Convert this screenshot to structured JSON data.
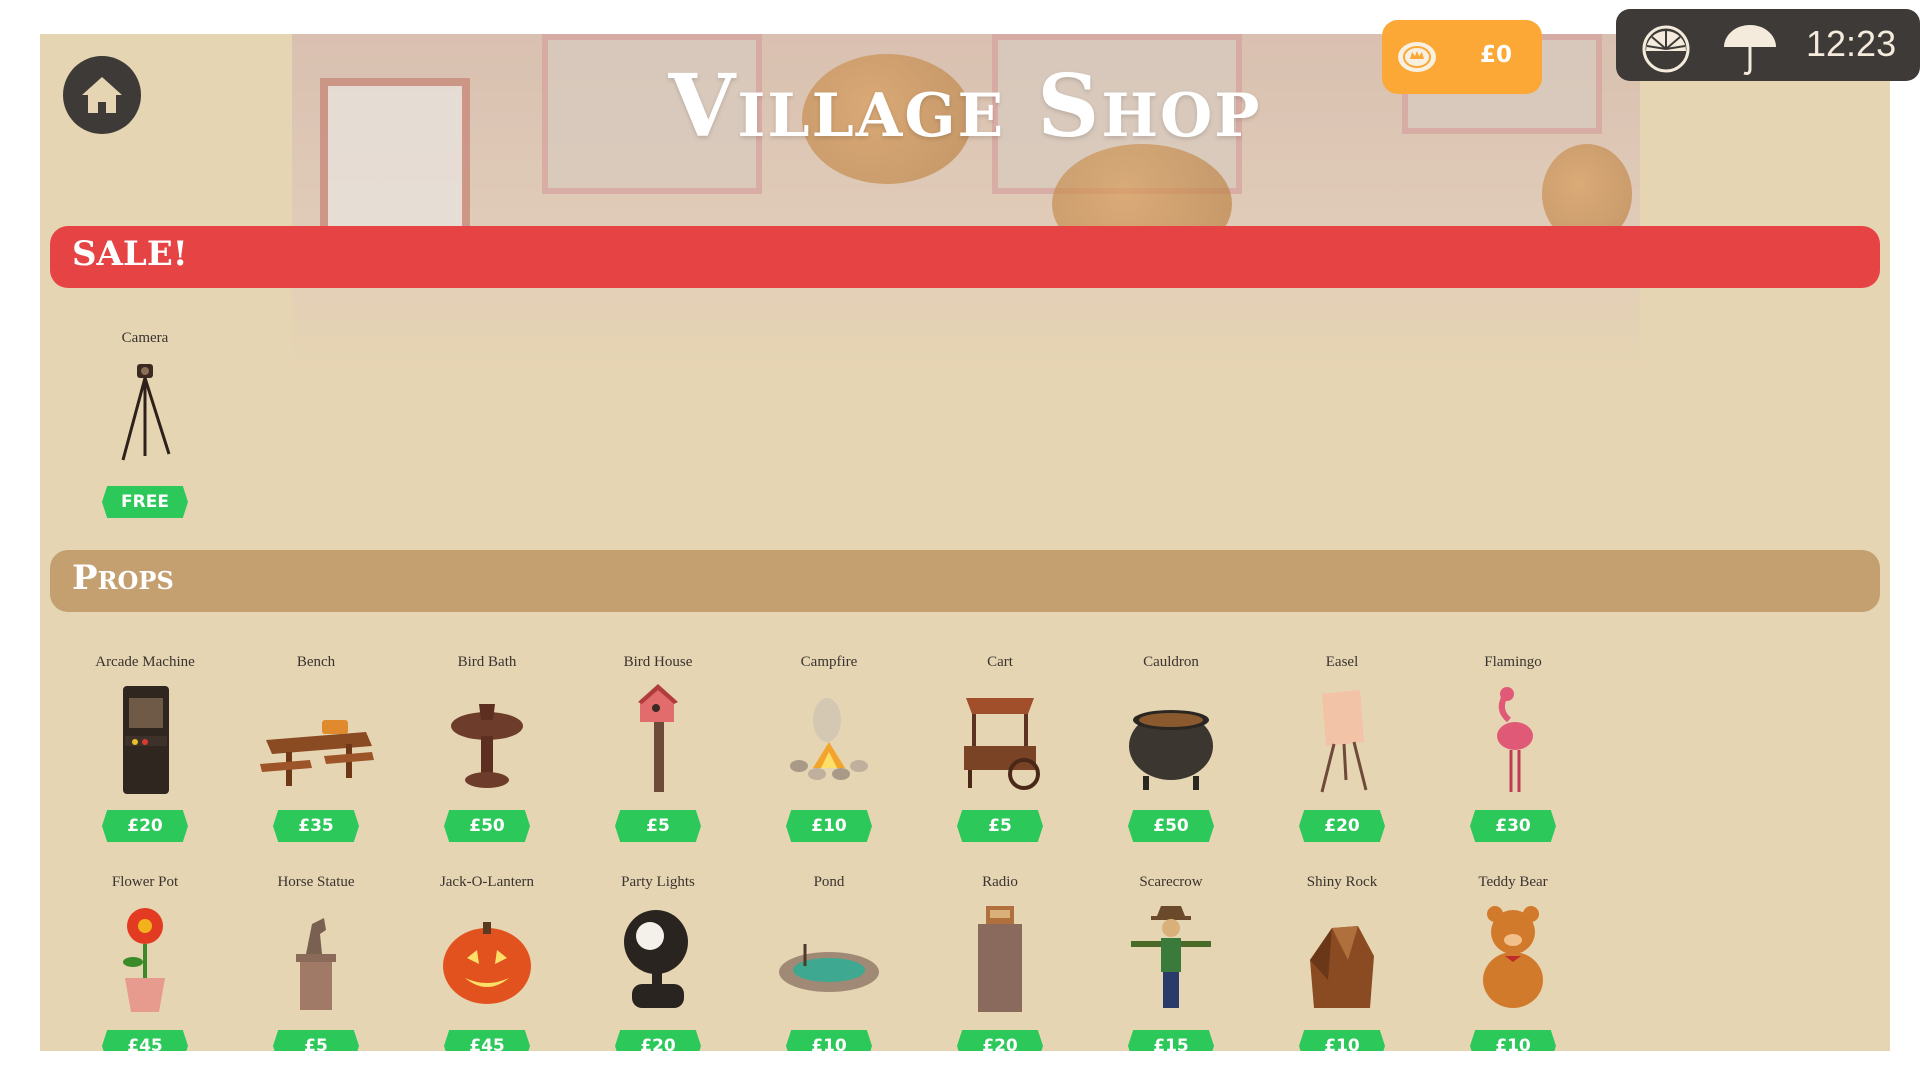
{
  "header": {
    "title": "Village Shop"
  },
  "hud": {
    "coins": "£0",
    "time": "12:23"
  },
  "sections": {
    "sale": {
      "label": "SALE!",
      "items": [
        {
          "name": "Camera",
          "price": "FREE"
        }
      ]
    },
    "props": {
      "label": "Props",
      "items": [
        {
          "name": "Arcade Machine",
          "price": "£20"
        },
        {
          "name": "Bench",
          "price": "£35"
        },
        {
          "name": "Bird Bath",
          "price": "£50"
        },
        {
          "name": "Bird House",
          "price": "£5"
        },
        {
          "name": "Campfire",
          "price": "£10"
        },
        {
          "name": "Cart",
          "price": "£5"
        },
        {
          "name": "Cauldron",
          "price": "£50"
        },
        {
          "name": "Easel",
          "price": "£20"
        },
        {
          "name": "Flamingo",
          "price": "£30"
        },
        {
          "name": "Flower Pot",
          "price": "£45"
        },
        {
          "name": "Horse Statue",
          "price": "£5"
        },
        {
          "name": "Jack-O-Lantern",
          "price": "£45"
        },
        {
          "name": "Party Lights",
          "price": "£20"
        },
        {
          "name": "Pond",
          "price": "£10"
        },
        {
          "name": "Radio",
          "price": "£20"
        },
        {
          "name": "Scarecrow",
          "price": "£15"
        },
        {
          "name": "Shiny Rock",
          "price": "£10"
        },
        {
          "name": "Teddy Bear",
          "price": "£10"
        }
      ]
    }
  },
  "colors": {
    "background": "#e6d5b3",
    "sale_bar": "#e54344",
    "props_bar": "#c4a071",
    "price_tag": "#2dc85a",
    "coin_panel": "#fba836",
    "hud_panel": "#3d3a38"
  },
  "icons": [
    "home-icon",
    "coin-icon",
    "sun-icon",
    "umbrella-icon"
  ]
}
